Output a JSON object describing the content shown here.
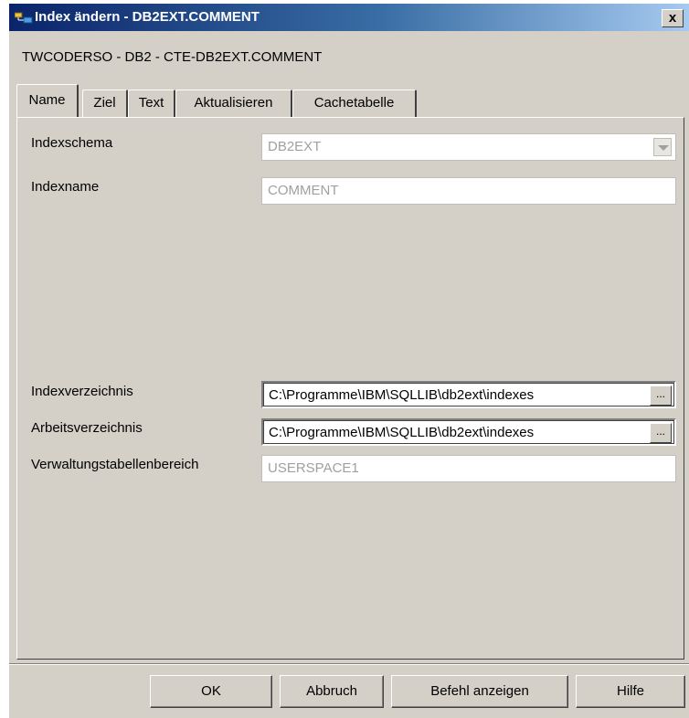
{
  "window": {
    "title": "Index ändern - DB2EXT.COMMENT",
    "close_label": "x",
    "subtitle": "TWCODERSO - DB2 - CTE-DB2EXT.COMMENT"
  },
  "tabs": [
    {
      "label": "Name",
      "active": true
    },
    {
      "label": "Ziel",
      "active": false
    },
    {
      "label": "Text",
      "active": false
    },
    {
      "label": "Aktualisieren",
      "active": false
    },
    {
      "label": "Cachetabelle",
      "active": false
    }
  ],
  "form": {
    "index_schema": {
      "label": "Indexschema",
      "value": "DB2EXT"
    },
    "index_name": {
      "label": "Indexname",
      "value": "COMMENT"
    },
    "index_directory": {
      "label": "Indexverzeichnis",
      "value": "C:\\Programme\\IBM\\SQLLIB\\db2ext\\indexes",
      "browse_label": "..."
    },
    "work_directory": {
      "label": "Arbeitsverzeichnis",
      "value": "C:\\Programme\\IBM\\SQLLIB\\db2ext\\indexes",
      "browse_label": "..."
    },
    "admin_tablespace": {
      "label": "Verwaltungstabellenbereich",
      "value": "USERSPACE1"
    }
  },
  "buttons": {
    "ok": "OK",
    "cancel": "Abbruch",
    "show_command": "Befehl anzeigen",
    "help": "Hilfe"
  },
  "colors": {
    "titlebar_start": "#0a246a",
    "titlebar_end": "#a6caf0",
    "dialog_bg": "#d4d0c8"
  }
}
